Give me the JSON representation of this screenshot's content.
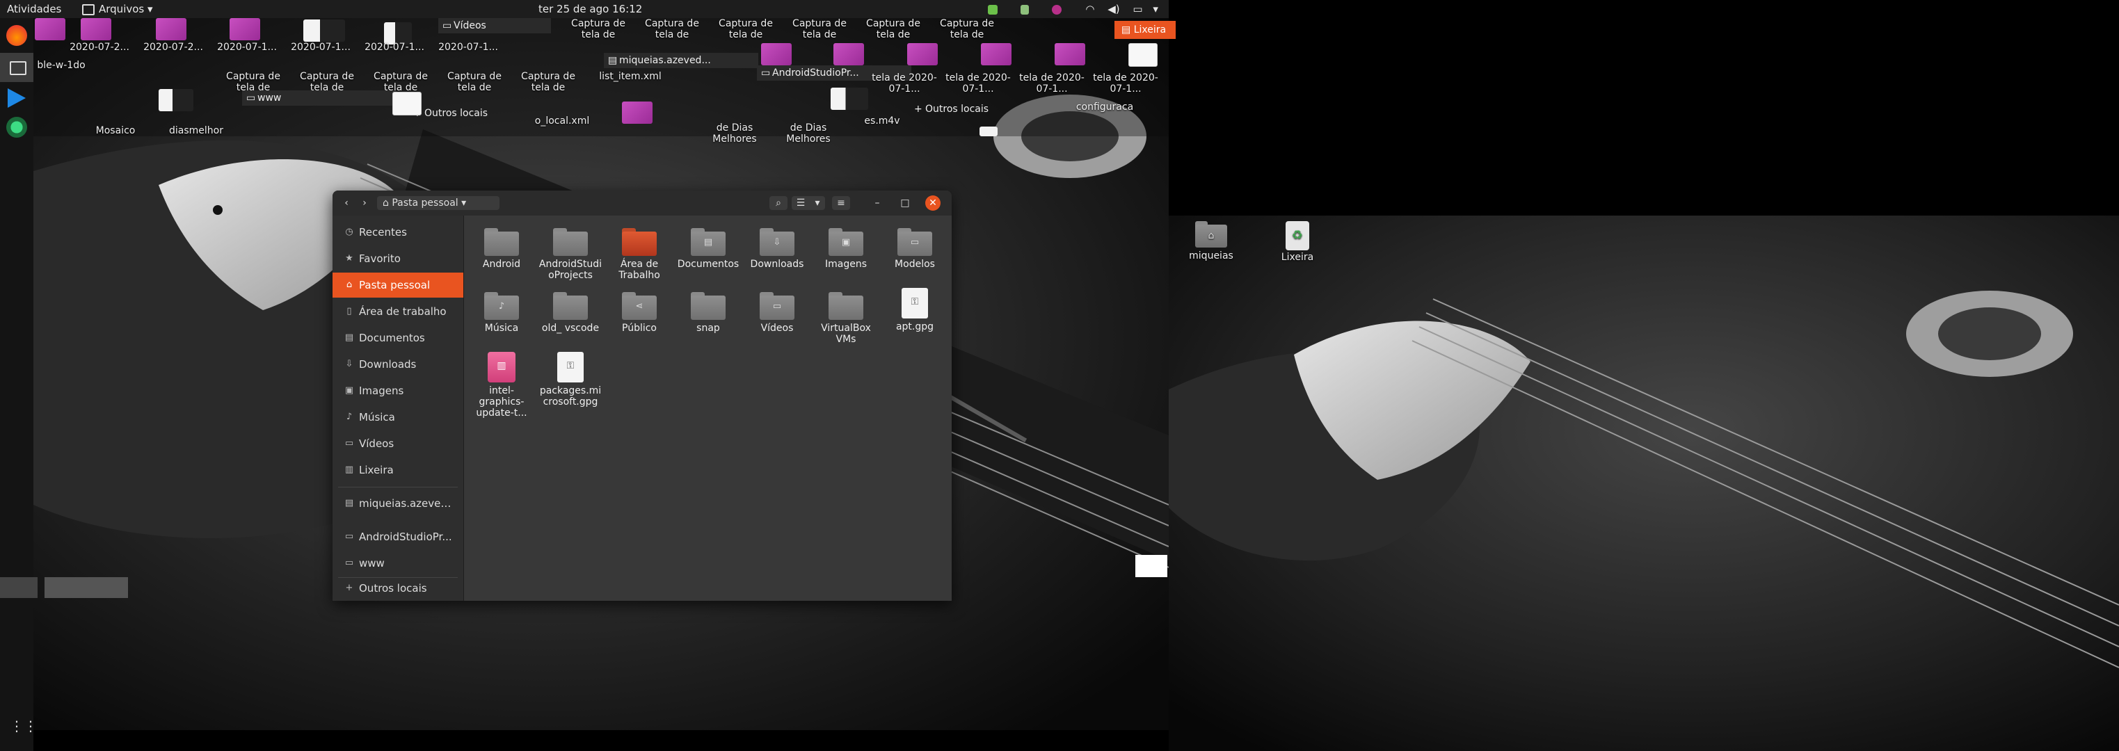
{
  "topbar": {
    "activities": "Atividades",
    "app_menu": "Arquivos",
    "clock": "ter 25 de ago  16:12",
    "tray_label": "Lixeira"
  },
  "desktop_strip": {
    "row1": [
      "2020-07-2...",
      "2020-07-2...",
      "2020-07-1...",
      "2020-07-1...",
      "2020-07-1...",
      "2020-07-1..."
    ],
    "captura": "Captura de tela de",
    "row1_right": [
      "Captura de tela de",
      "Captura de tela de",
      "Captura de tela de",
      "Captura de tela de",
      "Captura de tela de",
      "Captura de tela de"
    ],
    "videos": "Vídeos",
    "miqueias_ref": "miqueias.azeved...",
    "android_ref": "AndroidStudioPr...",
    "www": "www",
    "outros": "Outros locais",
    "row2": [
      "Captura de tela de",
      "Captura de tela de",
      "Captura de tela de",
      "Captura de tela de",
      "Captura de tela de",
      "list_item.xml"
    ],
    "row2_right": [
      "tela de 2020-07-1...",
      "tela de 2020-07-1...",
      "tela de 2020-07-1...",
      "tela de 2020-07-1...",
      "tela de 2020-07-1..."
    ],
    "row3": [
      "Mosaico",
      "diasmelhor",
      "o_local.xml",
      "de Dias Melhores",
      "de Dias Melhores",
      "es.m4v",
      "configuraca"
    ],
    "bile": "ble-w-1do"
  },
  "file_manager": {
    "location": "Pasta pessoal",
    "sidebar": [
      {
        "icon": "clock-icon",
        "label": "Recentes"
      },
      {
        "icon": "star-icon",
        "label": "Favorito"
      },
      {
        "icon": "home-icon",
        "label": "Pasta pessoal"
      },
      {
        "icon": "desktop-icon",
        "label": "Área de trabalho"
      },
      {
        "icon": "document-icon",
        "label": "Documentos"
      },
      {
        "icon": "download-icon",
        "label": "Downloads"
      },
      {
        "icon": "image-icon",
        "label": "Imagens"
      },
      {
        "icon": "music-icon",
        "label": "Música"
      },
      {
        "icon": "video-icon",
        "label": "Vídeos"
      },
      {
        "icon": "trash-icon",
        "label": "Lixeira"
      },
      {
        "icon": "network-icon",
        "label": "miqueias.azeved..."
      },
      {
        "icon": "folder-icon",
        "label": "AndroidStudioPr..."
      },
      {
        "icon": "folder-icon",
        "label": "www"
      },
      {
        "icon": "plus-icon",
        "label": "Outros locais"
      }
    ],
    "files": [
      {
        "name": "Android",
        "kind": "folder"
      },
      {
        "name": "AndroidStudioProjects",
        "kind": "folder"
      },
      {
        "name": "Área de Trabalho",
        "kind": "folder-accent"
      },
      {
        "name": "Documentos",
        "kind": "folder"
      },
      {
        "name": "Downloads",
        "kind": "folder"
      },
      {
        "name": "Imagens",
        "kind": "folder"
      },
      {
        "name": "Modelos",
        "kind": "folder"
      },
      {
        "name": "Música",
        "kind": "folder"
      },
      {
        "name": "old_ vscode",
        "kind": "folder"
      },
      {
        "name": "Público",
        "kind": "folder"
      },
      {
        "name": "snap",
        "kind": "folder"
      },
      {
        "name": "Vídeos",
        "kind": "folder"
      },
      {
        "name": "VirtualBox VMs",
        "kind": "folder"
      },
      {
        "name": "apt.gpg",
        "kind": "file"
      },
      {
        "name": "intel-graphics-update-t...",
        "kind": "package"
      },
      {
        "name": "packages.microsoft.gpg",
        "kind": "file"
      }
    ]
  },
  "right_desktop": {
    "home": "miqueias",
    "trash": "Lixeira"
  },
  "colors": {
    "accent": "#e95420",
    "topbar": "#1d1d1d",
    "window": "#383838"
  }
}
